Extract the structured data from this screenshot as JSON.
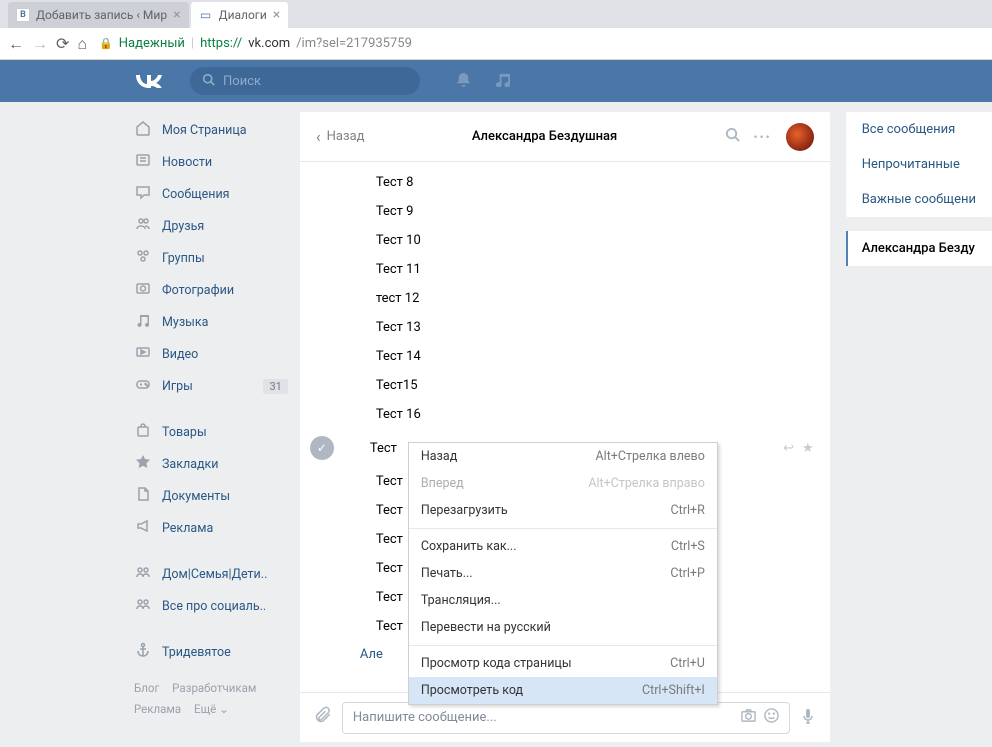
{
  "browser": {
    "tabs": [
      {
        "title": "Добавить запись ‹ Мир",
        "favicon": "B",
        "active": false
      },
      {
        "title": "Диалоги",
        "favicon": "chat",
        "active": true
      }
    ],
    "secure_label": "Надежный",
    "url_prefix": "https://",
    "url_host": "vk.com",
    "url_path": "/im?sel=217935759"
  },
  "header": {
    "search_placeholder": "Поиск"
  },
  "sidebar": {
    "items": [
      {
        "icon": "home",
        "label": "Моя Страница"
      },
      {
        "icon": "news",
        "label": "Новости"
      },
      {
        "icon": "msg",
        "label": "Сообщения"
      },
      {
        "icon": "friends",
        "label": "Друзья"
      },
      {
        "icon": "groups",
        "label": "Группы"
      },
      {
        "icon": "photo",
        "label": "Фотографии"
      },
      {
        "icon": "music",
        "label": "Музыка"
      },
      {
        "icon": "video",
        "label": "Видео"
      },
      {
        "icon": "games",
        "label": "Игры",
        "badge": "31"
      }
    ],
    "items2": [
      {
        "icon": "bag",
        "label": "Товары"
      },
      {
        "icon": "star",
        "label": "Закладки"
      },
      {
        "icon": "doc",
        "label": "Документы"
      },
      {
        "icon": "ads",
        "label": "Реклама"
      }
    ],
    "items3": [
      {
        "icon": "group",
        "label": "Дом|Семья|Дети.."
      },
      {
        "icon": "group",
        "label": "Все про социаль.."
      }
    ],
    "items4": [
      {
        "icon": "anchor",
        "label": "Тридевятое"
      }
    ],
    "footer": {
      "blog": "Блог",
      "devs": "Разработчикам",
      "ads": "Реклама",
      "more": "Ещё ⌄"
    }
  },
  "conv": {
    "back": "Назад",
    "title": "Александра Бездушная"
  },
  "messages": [
    "Тест 8",
    "Тест 9",
    "Тест 10",
    "Тест 11",
    "тест 12",
    "Тест 13",
    "Тест 14",
    "Тест15",
    "Тест 16"
  ],
  "partial_msgs": [
    "Тест",
    "Тест",
    "Тест",
    "Тест",
    "Тест",
    "Тест",
    "Тест"
  ],
  "author_partial": "Але",
  "ctx": {
    "items": [
      {
        "label": "Назад",
        "shortcut": "Alt+Стрелка влево",
        "disabled": false
      },
      {
        "label": "Вперед",
        "shortcut": "Alt+Стрелка вправо",
        "disabled": true
      },
      {
        "label": "Перезагрузить",
        "shortcut": "Ctrl+R",
        "disabled": false
      }
    ],
    "items2": [
      {
        "label": "Сохранить как...",
        "shortcut": "Ctrl+S"
      },
      {
        "label": "Печать...",
        "shortcut": "Ctrl+P"
      },
      {
        "label": "Трансляция...",
        "shortcut": ""
      },
      {
        "label": "Перевести на русский",
        "shortcut": ""
      }
    ],
    "items3": [
      {
        "label": "Просмотр кода страницы",
        "shortcut": "Ctrl+U"
      },
      {
        "label": "Просмотреть код",
        "shortcut": "Ctrl+Shift+I",
        "hover": true
      }
    ]
  },
  "compose": {
    "placeholder": "Напишите сообщение..."
  },
  "right": {
    "all": "Все сообщения",
    "unread": "Непрочитанные",
    "important": "Важные сообщени",
    "active": "Александра Безду"
  }
}
